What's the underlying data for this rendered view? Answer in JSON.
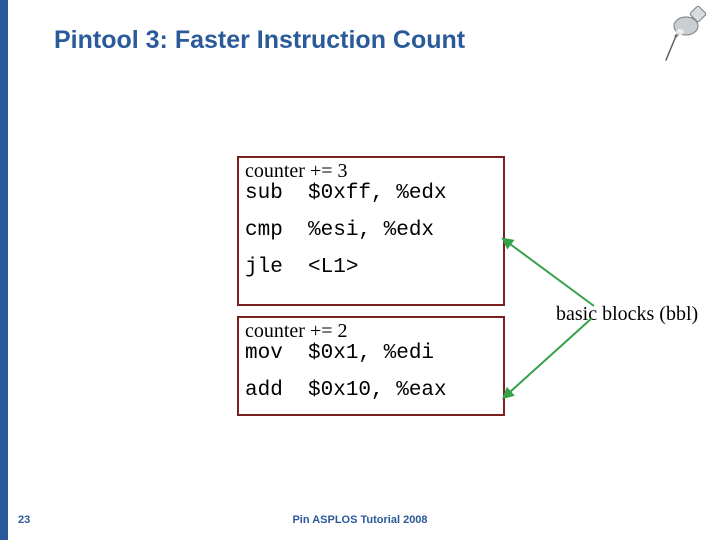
{
  "title": "Pintool 3: Faster Instruction Count",
  "pushpin_icon": "pushpin",
  "block1": {
    "counter_line": "counter += 3",
    "asm_sub": "sub  $0xff, %edx",
    "asm_cmp": "cmp  %esi, %edx",
    "asm_jle": "jle  <L1>"
  },
  "block2": {
    "counter_line": "counter += 2",
    "asm_mov": "mov  $0x1, %edi",
    "asm_add": "add  $0x10, %eax"
  },
  "annotation": "basic blocks (bbl)",
  "page_number": "23",
  "footer": "Pin ASPLOS Tutorial 2008",
  "colors": {
    "title_blue": "#2a5a9a",
    "box_border": "#7c1f1f",
    "arrow": "#35a24a"
  }
}
